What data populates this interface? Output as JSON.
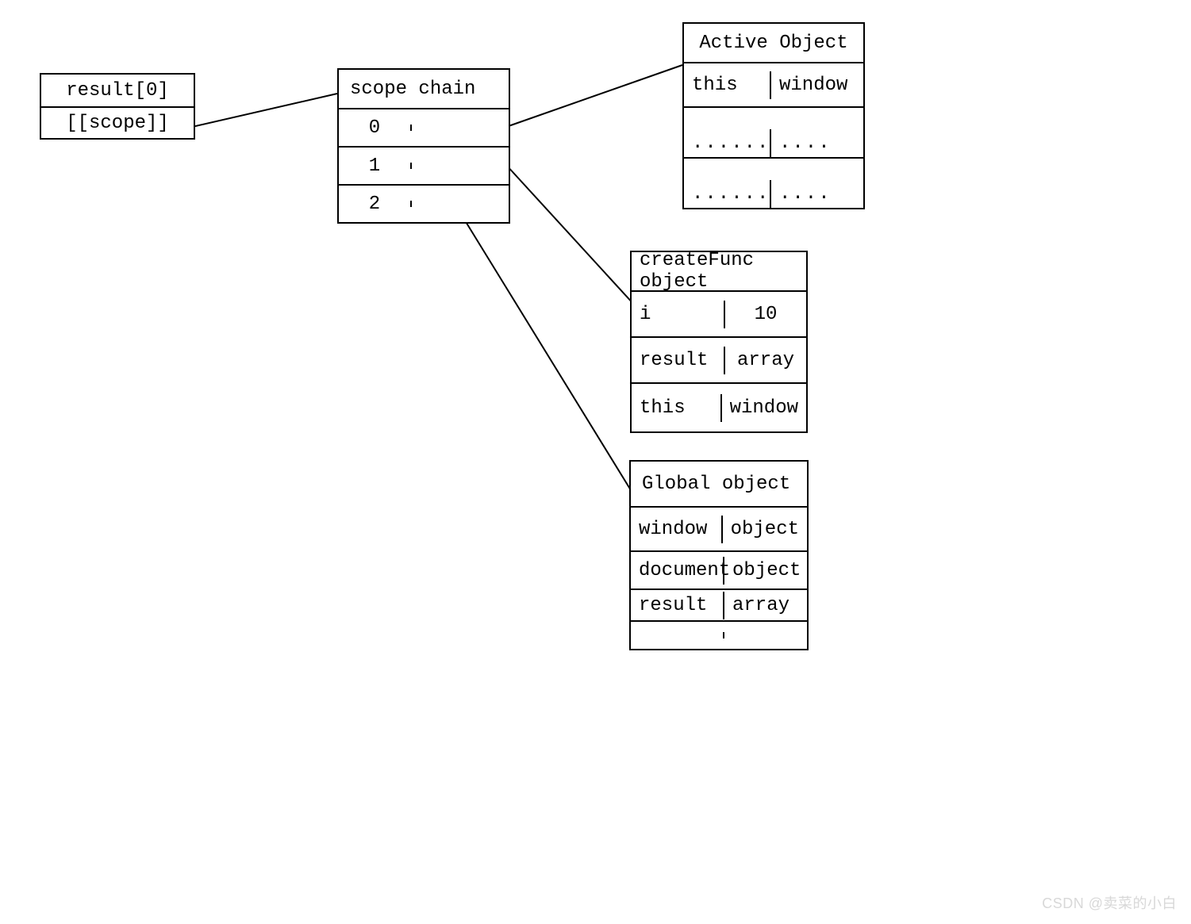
{
  "result_box": {
    "title": "result[0]",
    "scope": "[[scope]]"
  },
  "scope_chain": {
    "title": "scope chain",
    "rows": [
      "0",
      "1",
      "2"
    ]
  },
  "active_object": {
    "title": "Active Object",
    "rows": [
      {
        "k": "this",
        "v": "window"
      },
      {
        "k": "......",
        "v": "...."
      },
      {
        "k": "......",
        "v": "...."
      }
    ]
  },
  "create_func": {
    "title": "createFunc object",
    "rows": [
      {
        "k": "i",
        "v": "10"
      },
      {
        "k": "result",
        "v": "array"
      },
      {
        "k": "this",
        "v": "window"
      }
    ]
  },
  "global_object": {
    "title": "Global object",
    "rows": [
      {
        "k": "window",
        "v": "object"
      },
      {
        "k": "document",
        "v": "object"
      },
      {
        "k": "result",
        "v": "array"
      },
      {
        "k": "",
        "v": ""
      }
    ]
  },
  "watermark": "CSDN @卖菜的小白"
}
